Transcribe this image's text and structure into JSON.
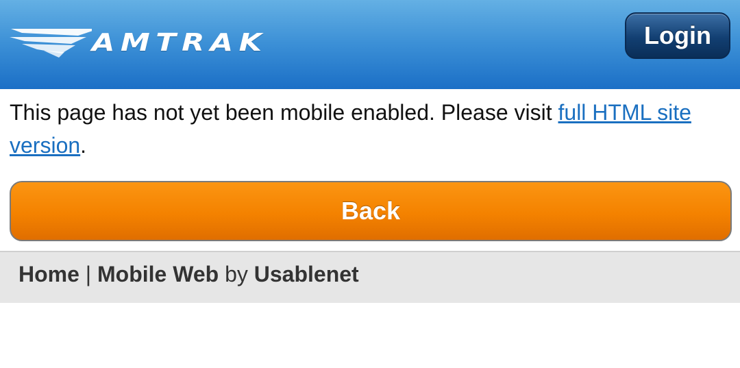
{
  "header": {
    "logo_text": "AMTRAK",
    "login_label": "Login",
    "colors": {
      "top": "#64b0e4",
      "bottom": "#1b6fc6"
    }
  },
  "message": {
    "text_before": "This page has not yet been mobile enabled. Please visit ",
    "link_text": "full HTML site version",
    "text_after": "."
  },
  "back_button": {
    "label": "Back",
    "color": "#f48200"
  },
  "footer": {
    "home_label": "Home",
    "separator": " | ",
    "mobile_web_label": "Mobile Web",
    "by_text": " by ",
    "vendor_label": "Usablenet",
    "background": "#e6e6e6"
  },
  "icons": {
    "logo": "amtrak-logo-icon"
  }
}
